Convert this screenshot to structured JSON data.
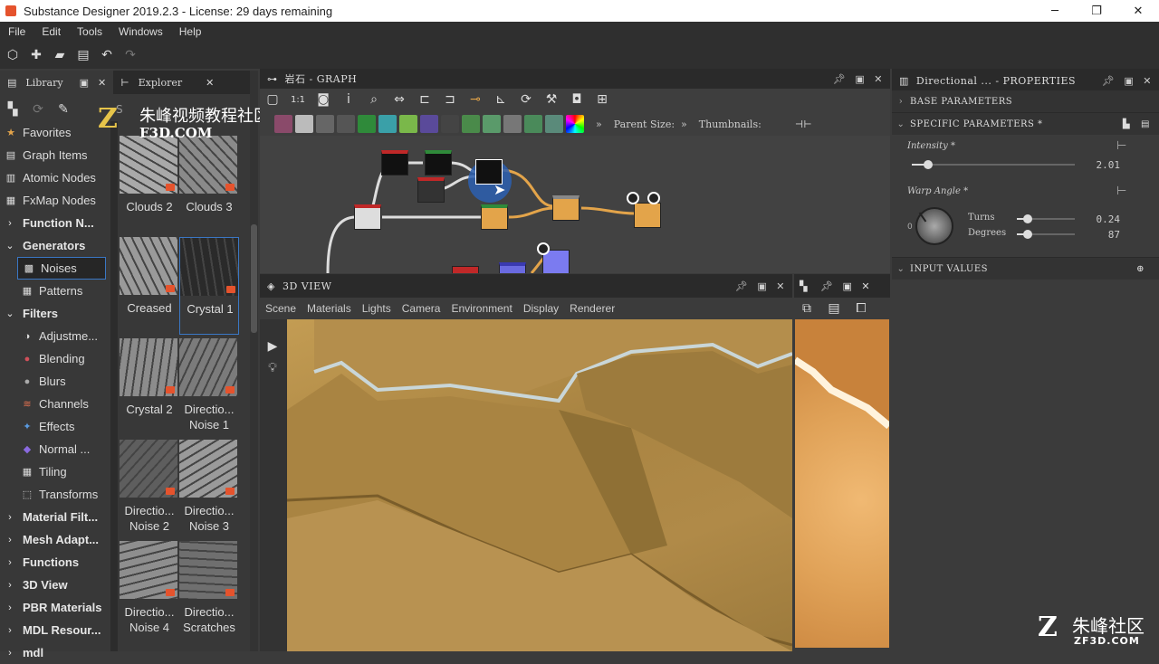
{
  "window": {
    "title": "Substance Designer 2019.2.3 - License: 29 days remaining"
  },
  "menu": [
    "File",
    "Edit",
    "Tools",
    "Windows",
    "Help"
  ],
  "library": {
    "tabs": [
      "Library",
      "Explorer"
    ],
    "search_placeholder": "S",
    "tree": [
      {
        "label": "Favorites",
        "icon": "star-icon",
        "type": "item"
      },
      {
        "label": "Graph Items",
        "icon": "graph-items-icon",
        "type": "item"
      },
      {
        "label": "Atomic Nodes",
        "icon": "atomic-nodes-icon",
        "type": "item"
      },
      {
        "label": "FxMap Nodes",
        "icon": "fxmap-icon",
        "type": "item"
      },
      {
        "label": "Function N...",
        "icon": "chevron-right-icon",
        "type": "cat"
      },
      {
        "label": "Generators",
        "icon": "chevron-down-icon",
        "type": "cat"
      },
      {
        "label": "Noises",
        "icon": "noise-icon",
        "type": "sub-sel"
      },
      {
        "label": "Patterns",
        "icon": "patterns-icon",
        "type": "sub"
      },
      {
        "label": "Filters",
        "icon": "chevron-down-icon",
        "type": "cat"
      },
      {
        "label": "Adjustme...",
        "icon": "adjust-icon",
        "type": "sub"
      },
      {
        "label": "Blending",
        "icon": "blending-icon",
        "type": "sub"
      },
      {
        "label": "Blurs",
        "icon": "blur-icon",
        "type": "sub"
      },
      {
        "label": "Channels",
        "icon": "channels-icon",
        "type": "sub"
      },
      {
        "label": "Effects",
        "icon": "effects-icon",
        "type": "sub"
      },
      {
        "label": "Normal ...",
        "icon": "normal-icon",
        "type": "sub"
      },
      {
        "label": "Tiling",
        "icon": "tiling-icon",
        "type": "sub"
      },
      {
        "label": "Transforms",
        "icon": "transforms-icon",
        "type": "sub"
      },
      {
        "label": "Material Filt...",
        "icon": "chevron-right-icon",
        "type": "cat"
      },
      {
        "label": "Mesh Adapt...",
        "icon": "chevron-right-icon",
        "type": "cat"
      },
      {
        "label": "Functions",
        "icon": "chevron-right-icon",
        "type": "cat"
      },
      {
        "label": "3D View",
        "icon": "chevron-right-icon",
        "type": "cat"
      },
      {
        "label": "PBR Materials",
        "icon": "chevron-right-icon",
        "type": "cat"
      },
      {
        "label": "MDL Resour...",
        "icon": "chevron-right-icon",
        "type": "cat"
      },
      {
        "label": "mdl",
        "icon": "chevron-right-icon",
        "type": "cat"
      }
    ],
    "thumbnails": [
      {
        "label": "Clouds 2",
        "shade": "#a9a9a9"
      },
      {
        "label": "Clouds 3",
        "shade": "#8a8a8a"
      },
      {
        "label": "Creased",
        "shade": "#9a9a9a"
      },
      {
        "label": "Crystal 1",
        "shade": "#2a2a2a"
      },
      {
        "label": "Crystal 2",
        "shade": "#8c8c8c"
      },
      {
        "label": "Directio... Noise 1",
        "shade": "#7b7b7b"
      },
      {
        "label": "Directio... Noise 2",
        "shade": "#5e5e5e"
      },
      {
        "label": "Directio... Noise 3",
        "shade": "#9a9a9a"
      },
      {
        "label": "Directio... Noise 4",
        "shade": "#8e8e8e"
      },
      {
        "label": "Directio... Scratches",
        "shade": "#6f6f6f"
      }
    ]
  },
  "watermark_top": {
    "line1": "朱峰视频教程社区",
    "line2": "F3D.COM"
  },
  "graph": {
    "title": "岩石 - GRAPH",
    "parent_size_label": "Parent Size:",
    "thumbnails_label": "Thumbnails:"
  },
  "view3d": {
    "title": "3D VIEW",
    "menu": [
      "Scene",
      "Materials",
      "Lights",
      "Camera",
      "Environment",
      "Display",
      "Renderer"
    ]
  },
  "properties": {
    "title": "Directional ... - PROPERTIES",
    "sections": [
      "BASE PARAMETERS",
      "SPECIFIC PARAMETERS *",
      "INPUT VALUES"
    ],
    "intensity": {
      "label": "Intensity *",
      "value": "2.01"
    },
    "warp_angle": {
      "label": "Warp Angle *",
      "turns_label": "Turns",
      "turns": "0.24",
      "degrees_label": "Degrees",
      "degrees": "87",
      "zero": "0"
    }
  },
  "watermark": {
    "brand": "朱峰社区",
    "url": "ZF3D.COM"
  },
  "colors": {
    "accent": "#3a77c4",
    "brand": "#e5532d",
    "node_orange": "#e3a44a"
  }
}
